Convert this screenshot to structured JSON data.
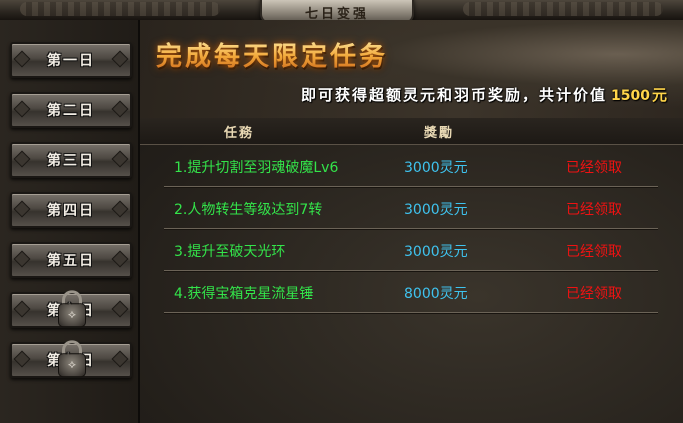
{
  "window": {
    "title": "七日变强"
  },
  "sidebar": {
    "tabs": [
      {
        "label": "第一日",
        "locked": false
      },
      {
        "label": "第二日",
        "locked": false
      },
      {
        "label": "第三日",
        "locked": false
      },
      {
        "label": "第四日",
        "locked": false
      },
      {
        "label": "第五日",
        "locked": false
      },
      {
        "label": "第六日",
        "locked": true
      },
      {
        "label": "第七日",
        "locked": true
      }
    ]
  },
  "banner": {
    "headline": "完成每天限定任务",
    "subline": "即可获得超额灵元和羽币奖励，共计价值",
    "amount": "1500",
    "unit": "元"
  },
  "table": {
    "headers": {
      "task": "任務",
      "reward": "獎勵"
    },
    "rows": [
      {
        "task": "1.提升切割至羽魂破魔Lv6",
        "reward": "3000灵元",
        "status": "已经领取"
      },
      {
        "task": "2.人物转生等级达到7转",
        "reward": "3000灵元",
        "status": "已经领取"
      },
      {
        "task": "3.提升至破天光环",
        "reward": "3000灵元",
        "status": "已经领取"
      },
      {
        "task": "4.获得宝箱克星流星锤",
        "reward": "8000灵元",
        "status": "已经领取"
      }
    ]
  },
  "colors": {
    "task_text": "#33e44a",
    "reward_text": "#3fc3ef",
    "status_text": "#f01212",
    "headline": "#f6c45a",
    "amount": "#ffd54a"
  },
  "icons": {
    "locked_tab": "padlock-icon"
  }
}
